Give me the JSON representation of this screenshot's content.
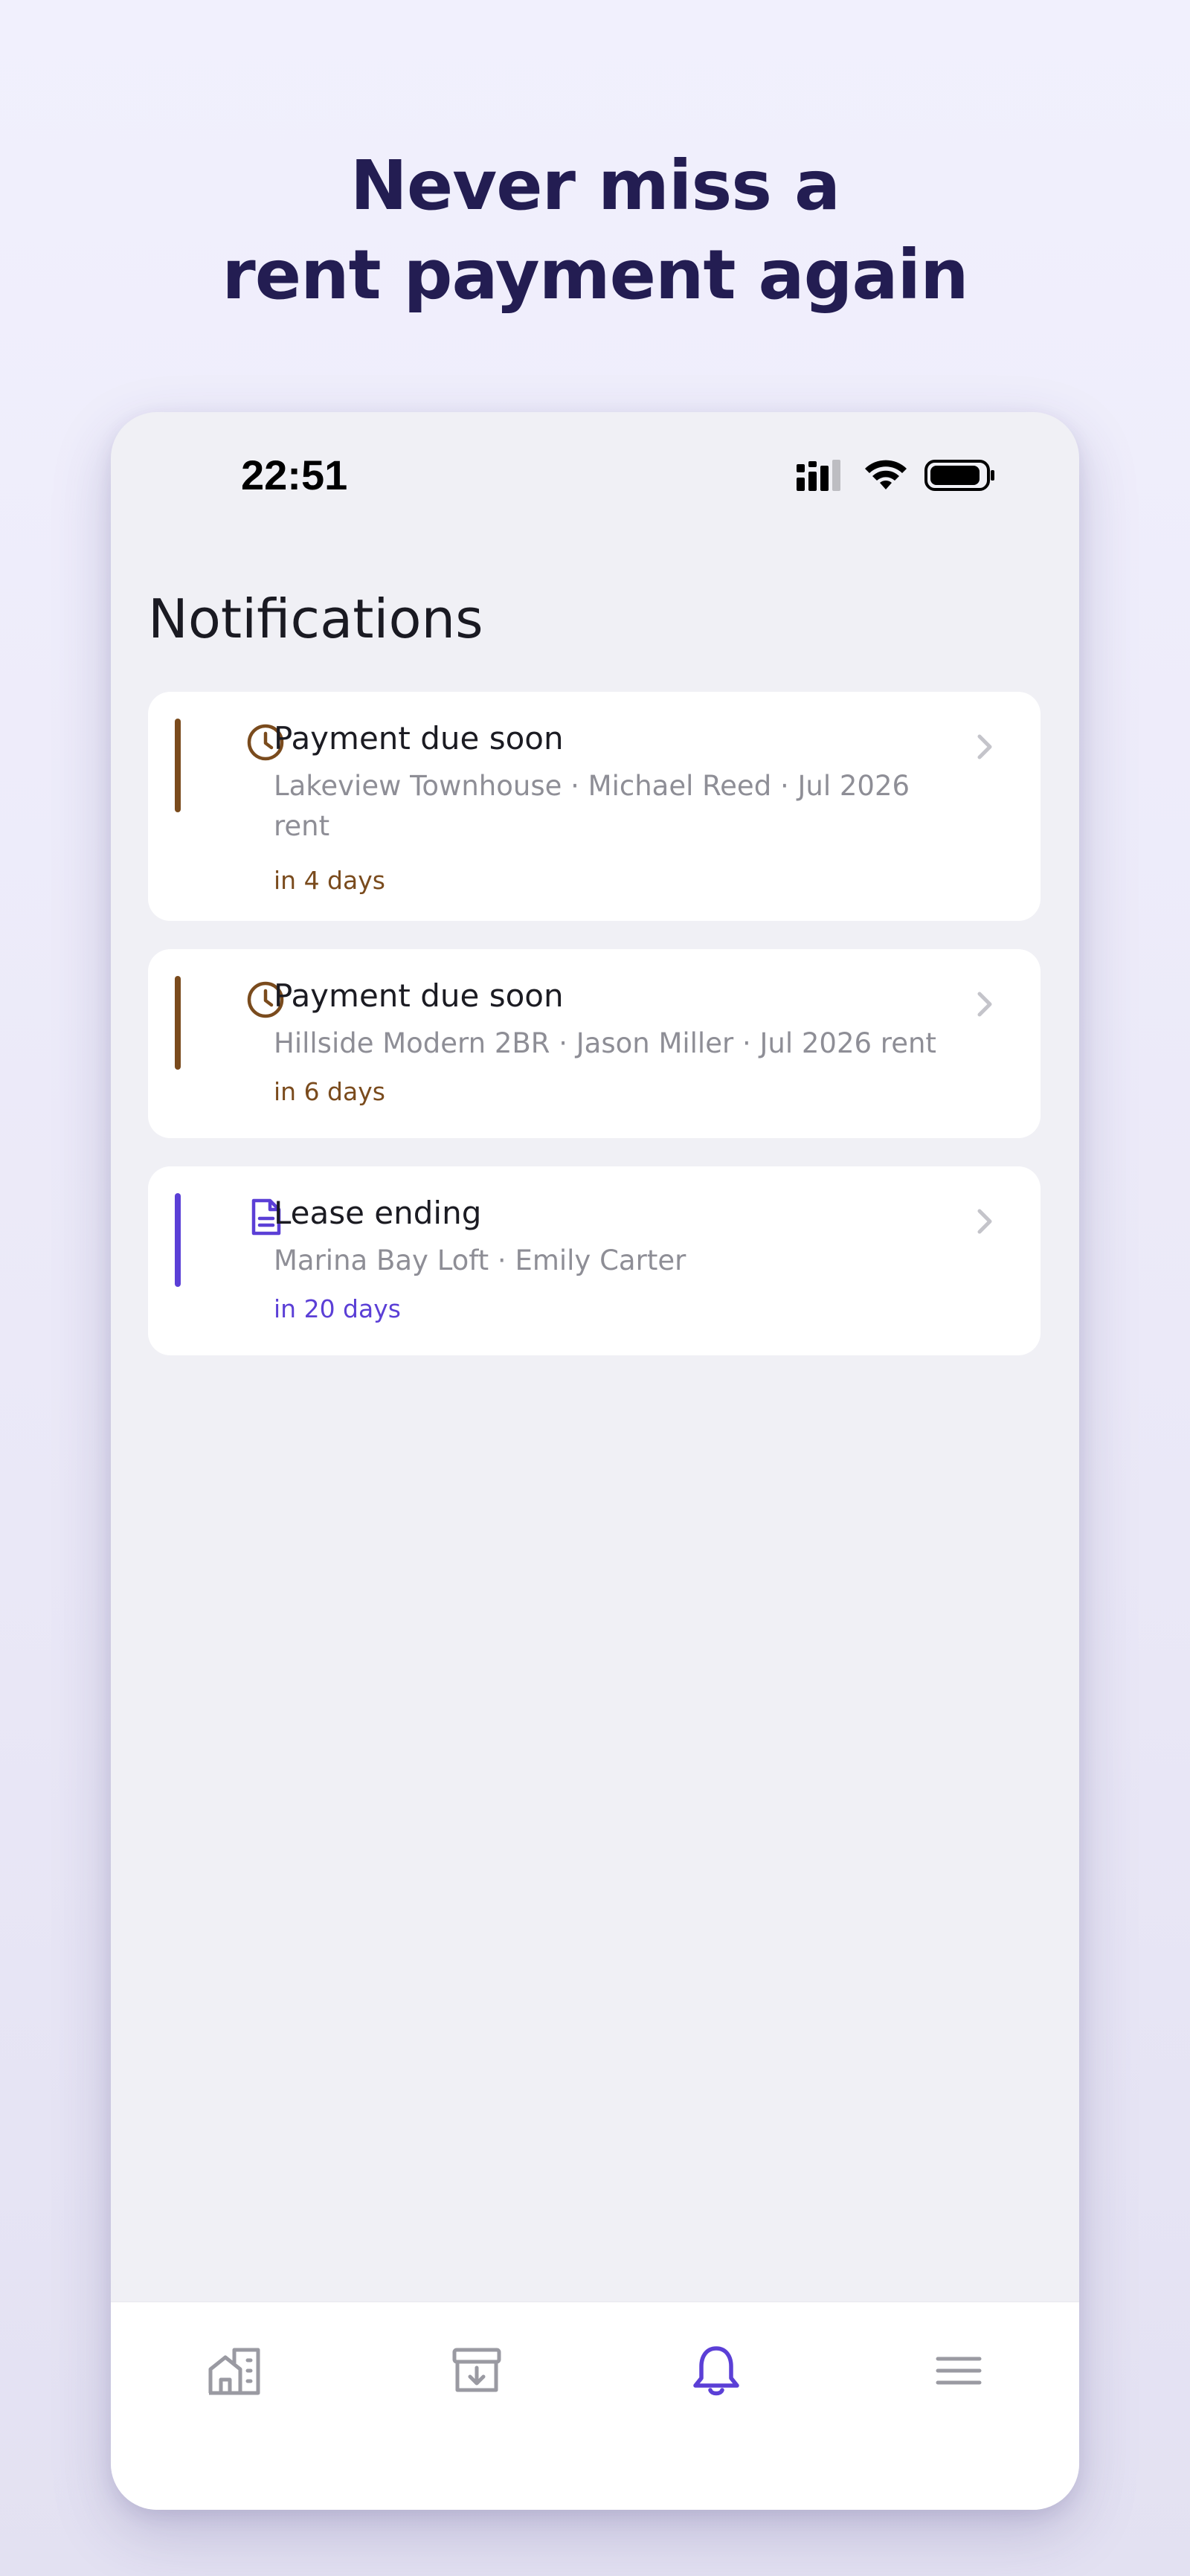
{
  "headline": {
    "line1": "Never miss a",
    "line2": "rent payment again"
  },
  "status_bar": {
    "time": "22:51",
    "icons": [
      "cellular-signal-icon",
      "wifi-icon",
      "battery-icon"
    ]
  },
  "screen": {
    "title": "Notifications"
  },
  "notifications": [
    {
      "type": "payment",
      "icon": "clock-icon",
      "title": "Payment due soon",
      "subtitle": "Lakeview Townhouse · Michael Reed · Jul 2026 rent",
      "due": "in 4 days",
      "color": "#7A4B1D"
    },
    {
      "type": "payment",
      "icon": "clock-icon",
      "title": "Payment due soon",
      "subtitle": "Hillside Modern 2BR · Jason Miller · Jul 2026 rent",
      "due": "in 6 days",
      "color": "#7A4B1D"
    },
    {
      "type": "lease",
      "icon": "document-icon",
      "title": "Lease ending",
      "subtitle": "Marina Bay Loft · Emily Carter",
      "due": "in 20 days",
      "color": "#5B3FD6"
    }
  ],
  "tabbar": {
    "tabs": [
      {
        "icon": "properties-icon",
        "active": false
      },
      {
        "icon": "archive-icon",
        "active": false
      },
      {
        "icon": "bell-icon",
        "active": true
      },
      {
        "icon": "menu-icon",
        "active": false
      }
    ],
    "active_color": "#5B3FD6",
    "inactive_color": "#9A9AA2"
  },
  "colors": {
    "headline": "#231D52",
    "background": "#F0F0F5",
    "payment_accent": "#7A4B1D",
    "lease_accent": "#5B3FD6",
    "subtitle": "#8E8E96"
  }
}
